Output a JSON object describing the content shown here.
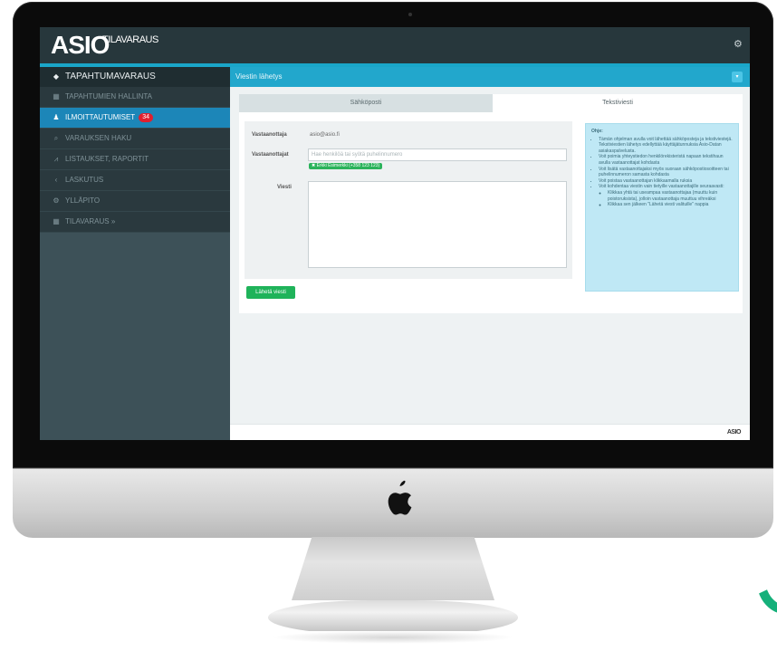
{
  "app": {
    "logo": "ASIO",
    "logo_suffix": "TILAVARAUS",
    "footer_logo": "ASIO"
  },
  "sidebar": {
    "items": [
      {
        "label": "TAPAHTUMAVARAUS",
        "icon": "diamond-icon"
      },
      {
        "label": "TAPAHTUMIEN HALLINTA",
        "icon": "calendar-icon"
      },
      {
        "label": "ILMOITTAUTUMISET",
        "icon": "users-icon",
        "badge": "34"
      },
      {
        "label": "VARAUKSEN HAKU",
        "icon": "search-icon"
      },
      {
        "label": "LISTAUKSET, RAPORTIT",
        "icon": "chart-icon"
      },
      {
        "label": "LASKUTUS",
        "icon": "chevron-left-icon"
      },
      {
        "label": "YLLÄPITO",
        "icon": "cogs-icon"
      },
      {
        "label": "TILAVARAUS »",
        "icon": "calendar-icon"
      }
    ]
  },
  "content": {
    "title": "Viestin lähetys",
    "tabs": [
      "Sähköposti",
      "Tekstiviesti"
    ],
    "form": {
      "sender_label": "Vastaanottaja",
      "sender_value": "asio@asio.fi",
      "recipients_label": "Vastaanottajat",
      "recipients_placeholder": "Hae henkilöä tai syötä puhelinnumero",
      "recipient_tag": "✖ Erkki Esimerkki (+358 123 123)",
      "message_label": "Viesti",
      "send_button": "Lähetä viesti"
    },
    "help": {
      "title": "Ohje:",
      "items": [
        "Tämän ohjelman avulla voit lähettää sähköposteja ja tekstiviestejä. Tekstiviestien lähetys edellyttää käyttäjätunnuksia Asio-Datan asiakaspalvelusta.",
        "Voit poimia yhteystiedon henkilörekisteristä napaan tekstihaun avulla vastaanottajat kohdasta",
        "Voit lisätä vastaanottajaksi myös suoraan sähköpostiosoitteen tai puhelinnumeron samasta kohdasta",
        "Voit poistaa vastaanottajan klikkaamalla ruksia",
        "Voit kohdentaa viestin vain tietyille vastaanottajille seuraavasti:"
      ],
      "sub_items": [
        "Klikkaa yhtä tai useampaa vastaanottajaa (muuttu kuin poistoruksista), jolloin vastaanottaja muuttuu vihreäksi",
        "Klikkaa sen jälkeen \"Lähetä viesti valituille\" nappia"
      ]
    }
  }
}
